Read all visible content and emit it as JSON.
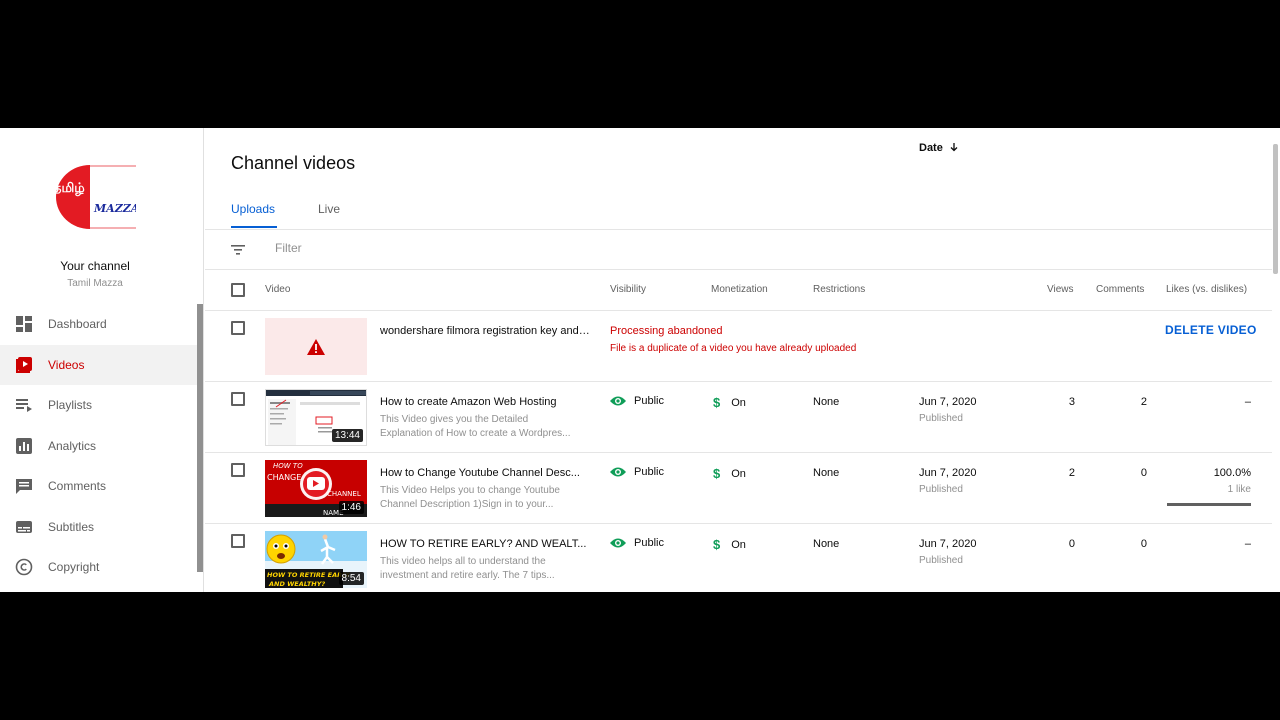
{
  "sidebar": {
    "channel_title": "Your channel",
    "channel_name": "Tamil Mazza",
    "logo_text_1": "தமிழ்",
    "logo_text_2": "MAZZA",
    "items": [
      {
        "label": "Dashboard",
        "icon": "dashboard-icon",
        "active": false
      },
      {
        "label": "Videos",
        "icon": "videos-icon",
        "active": true
      },
      {
        "label": "Playlists",
        "icon": "playlists-icon",
        "active": false
      },
      {
        "label": "Analytics",
        "icon": "analytics-icon",
        "active": false
      },
      {
        "label": "Comments",
        "icon": "comments-icon",
        "active": false
      },
      {
        "label": "Subtitles",
        "icon": "subtitles-icon",
        "active": false
      },
      {
        "label": "Copyright",
        "icon": "copyright-icon",
        "active": false
      }
    ]
  },
  "main": {
    "title": "Channel videos",
    "tabs": [
      {
        "label": "Uploads",
        "active": true
      },
      {
        "label": "Live",
        "active": false
      }
    ],
    "filter_placeholder": "Filter",
    "columns": {
      "video": "Video",
      "visibility": "Visibility",
      "monetization": "Monetization",
      "restrictions": "Restrictions",
      "date": "Date",
      "views": "Views",
      "comments": "Comments",
      "likes": "Likes (vs. dislikes)"
    },
    "rows": [
      {
        "title": "wondershare filmora registration key and ...",
        "error_title": "Processing abandoned",
        "error_detail": "File is a duplicate of a video you have already uploaded",
        "action": "DELETE VIDEO"
      },
      {
        "title": "How to create Amazon Web Hosting",
        "description": "This Video gives you the Detailed Explanation of How to create a Wordpres...",
        "duration": "13:44",
        "visibility": "Public",
        "monetization": "On",
        "restrictions": "None",
        "date": "Jun 7, 2020",
        "date_status": "Published",
        "views": "3",
        "comments": "2",
        "likes": "–"
      },
      {
        "title": "How to Change Youtube Channel Desc...",
        "description": "This Video Helps you to change Youtube Channel Description 1)Sign in to your...",
        "duration": "1:46",
        "visibility": "Public",
        "monetization": "On",
        "restrictions": "None",
        "date": "Jun 7, 2020",
        "date_status": "Published",
        "views": "2",
        "comments": "0",
        "likes": "100.0%",
        "likes_detail": "1 like",
        "like_ratio": 1.0
      },
      {
        "title": "HOW TO RETIRE EARLY? AND WEALT...",
        "description": "This video helps all to understand the investment and retire early. The 7 tips...",
        "duration": "8:54",
        "visibility": "Public",
        "monetization": "On",
        "restrictions": "None",
        "date": "Jun 7, 2020",
        "date_status": "Published",
        "views": "0",
        "comments": "0",
        "likes": "–"
      }
    ],
    "thumbnail_text": {
      "row3_line1": "HOW TO",
      "row3_line2": "CHANGE",
      "row3_line3": "CHANNEL",
      "row3_line4": "NAME",
      "row4_line1": "HOW TO RETIRE EARLY",
      "row4_line2": "AND WEALTHY?"
    }
  },
  "colors": {
    "accent_blue": "#065fd4",
    "error_red": "#cc0000",
    "active_red": "#cc0000",
    "public_green": "#0f9d58"
  }
}
